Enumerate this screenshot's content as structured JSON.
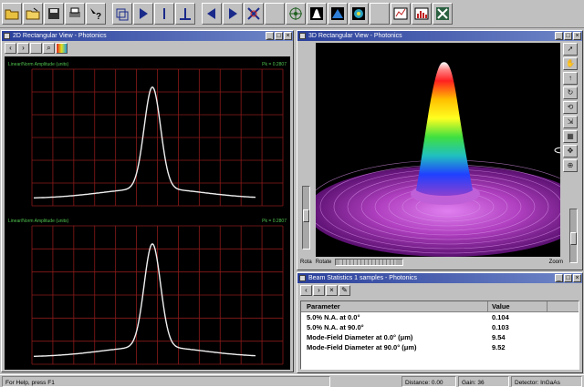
{
  "colors": {
    "accent_title": "#2a3f9a",
    "plot_background": "#000000",
    "plot_grid": "#8b1a1a",
    "plot_trace": "#f0f0f0",
    "plot_caption": "#4fc34f"
  },
  "toolbar": {
    "icons": [
      "folder-open-icon",
      "open-file-icon",
      "save-icon",
      "print-icon",
      "help-pointer-icon",
      "export-icon",
      "play-icon",
      "cursor-line-icon",
      "baseline-icon",
      "step-left-icon",
      "step-right-icon",
      "crosshair-icon",
      "blank-icon",
      "bullseye-icon",
      "profile-3d-icon",
      "pyramid-icon",
      "globe-icon",
      "blank-icon",
      "chart-icon",
      "histogram-icon",
      "settings-icon"
    ]
  },
  "left_window": {
    "title": "2D Rectangular View - Photonics",
    "plots": [
      {
        "caption_left": "Linear/Norm  Amplitude (units)",
        "caption_right": "Pk = 0.2807"
      },
      {
        "caption_left": "Linear/Norm  Amplitude (units)",
        "caption_right": "Pk = 0.2807"
      }
    ]
  },
  "three_d_window": {
    "title": "3D Rectangular View - Photonics",
    "rotation_label": "Rota",
    "rotate_label": "Rotate",
    "zoom_label": "Zoom"
  },
  "stats_window": {
    "title": "Beam Statistics 1 samples - Photonics",
    "columns": [
      "Parameter",
      "Value"
    ],
    "rows": [
      {
        "parameter": "5.0% N.A. at 0.0°",
        "value": "0.104"
      },
      {
        "parameter": "5.0% N.A. at 90.0°",
        "value": "0.103"
      },
      {
        "parameter": "Mode-Field Diameter at 0.0° (μm)",
        "value": "9.54"
      },
      {
        "parameter": "Mode-Field Diameter at 90.0° (μm)",
        "value": "9.52"
      }
    ]
  },
  "status_bar": {
    "help": "For Help, press F1",
    "distance": "Distance: 0.00",
    "gain": "Gain: 36",
    "device": "Detector: InGaAs"
  }
}
